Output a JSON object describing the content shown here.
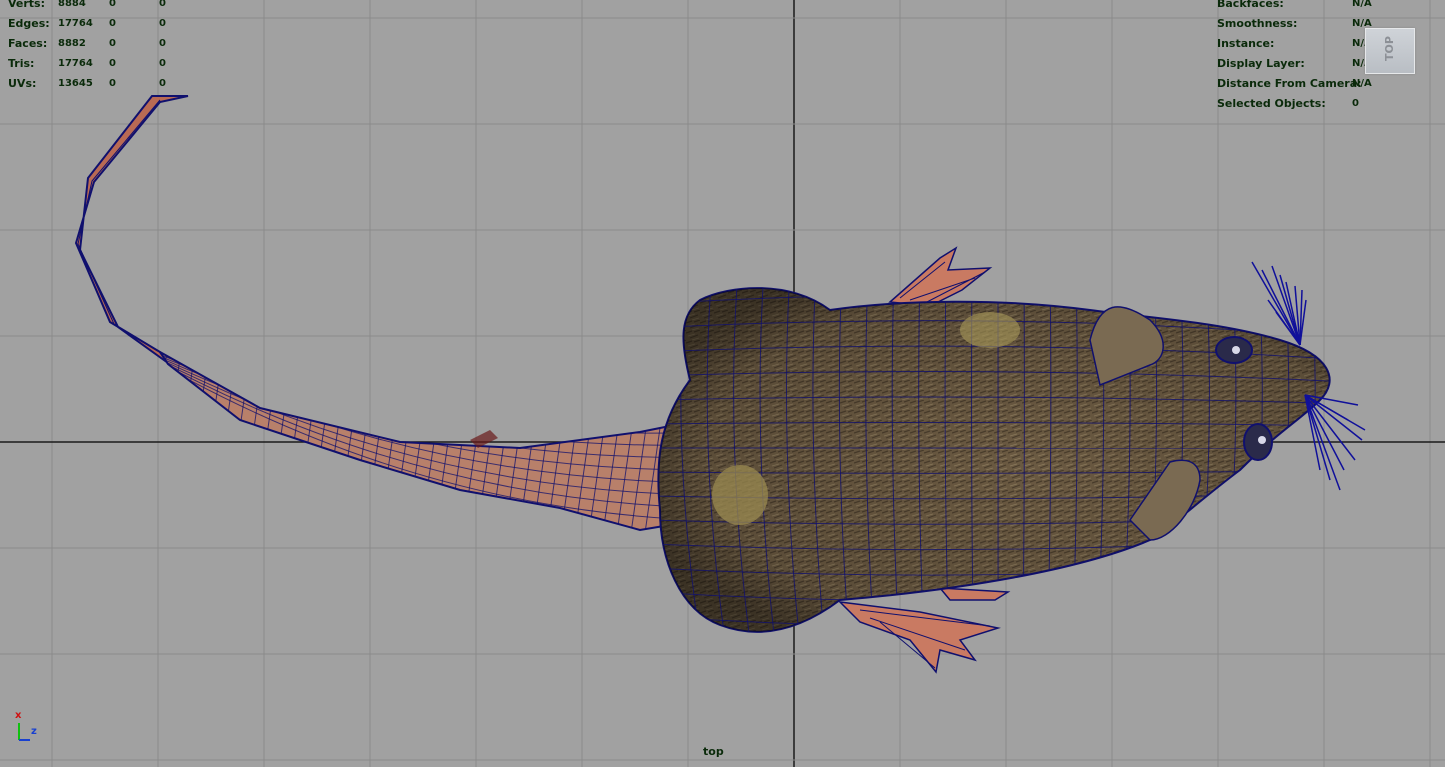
{
  "viewport": {
    "camera_name": "top",
    "view_cube_label": "TOP",
    "background_color": "#a1a1a1",
    "grid_color": "#8a8a8a",
    "axis_line_color": "#1a1a1a"
  },
  "stats_left": [
    {
      "label": "Verts:",
      "v1": "8884",
      "v2": "0",
      "v3": "0"
    },
    {
      "label": "Edges:",
      "v1": "17764",
      "v2": "0",
      "v3": "0"
    },
    {
      "label": "Faces:",
      "v1": "8882",
      "v2": "0",
      "v3": "0"
    },
    {
      "label": "Tris:",
      "v1": "17764",
      "v2": "0",
      "v3": "0"
    },
    {
      "label": "UVs:",
      "v1": "13645",
      "v2": "0",
      "v3": "0"
    }
  ],
  "stats_right": [
    {
      "label": "Backfaces:",
      "value": "N/A"
    },
    {
      "label": "Smoothness:",
      "value": "N/A"
    },
    {
      "label": "Instance:",
      "value": "N/A"
    },
    {
      "label": "Display Layer:",
      "value": "N/A"
    },
    {
      "label": "Distance From Camera:",
      "value": "N/A"
    },
    {
      "label": "Selected Objects:",
      "value": "0"
    }
  ],
  "axis_gizmo": {
    "x_label": "x",
    "z_label": "z",
    "x_color": "#d01010",
    "y_color": "#10c010",
    "z_color": "#1840d0"
  },
  "model": {
    "name": "rat-model",
    "wire_color": "#10106e",
    "fur_color": "#6b5a42",
    "skin_color": "#c07860"
  }
}
